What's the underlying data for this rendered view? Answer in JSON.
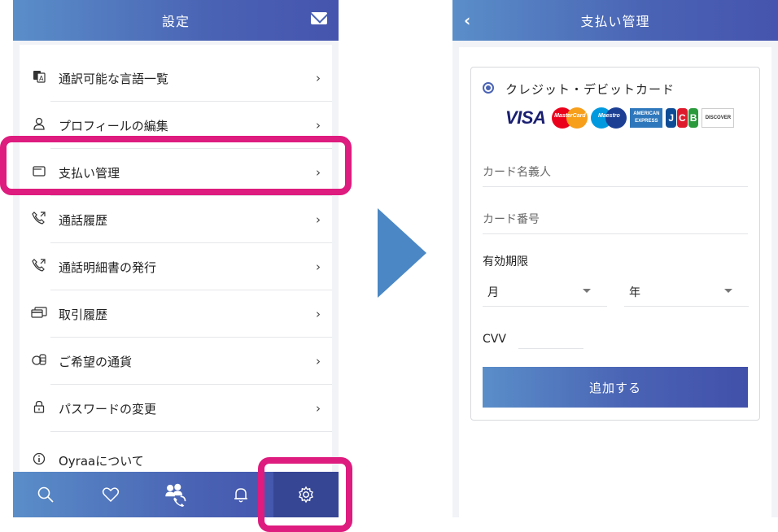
{
  "left_screen": {
    "header": {
      "title": "設定"
    },
    "menu_items": [
      {
        "label": "通訳可能な言語一覧",
        "icon": "translate-icon"
      },
      {
        "label": "プロフィールの編集",
        "icon": "person-icon"
      },
      {
        "label": "支払い管理",
        "icon": "wallet-icon"
      },
      {
        "label": "通話履歴",
        "icon": "phone-history-icon"
      },
      {
        "label": "通話明細書の発行",
        "icon": "phone-history-icon"
      },
      {
        "label": "取引履歴",
        "icon": "card-icon"
      },
      {
        "label": "ご希望の通貨",
        "icon": "coins-icon"
      },
      {
        "label": "パスワードの変更",
        "icon": "lock-icon"
      },
      {
        "label": "Oyraaについて",
        "icon": "info-icon"
      }
    ],
    "chevron": "›",
    "tabbar": {
      "tabs": [
        "search-icon",
        "heart-icon",
        "interpreter-call-icon",
        "bell-icon",
        "gear-icon"
      ],
      "active": "gear-icon"
    },
    "highlight_color": "#de1b7e"
  },
  "right_screen": {
    "header": {
      "title": "支払い管理",
      "back": "‹"
    },
    "payment_option": "クレジット・デビットカード",
    "card_brands": {
      "visa": "VISA",
      "mastercard": "MasterCard",
      "maestro": "Maestro",
      "amex": "AMERICAN EXPRESS",
      "jcb": [
        "J",
        "C",
        "B"
      ],
      "discover": "DISCOVER"
    },
    "fields": {
      "cardholder_placeholder": "カード名義人",
      "card_number_placeholder": "カード番号",
      "expiry_label": "有効期限",
      "month": "月",
      "year": "年",
      "cvv_label": "CVV"
    },
    "submit_label": "追加する"
  },
  "colors": {
    "brand_blue": "#4a63b4",
    "brand_light": "#5a8ec9",
    "arrow": "#4a87c4"
  }
}
